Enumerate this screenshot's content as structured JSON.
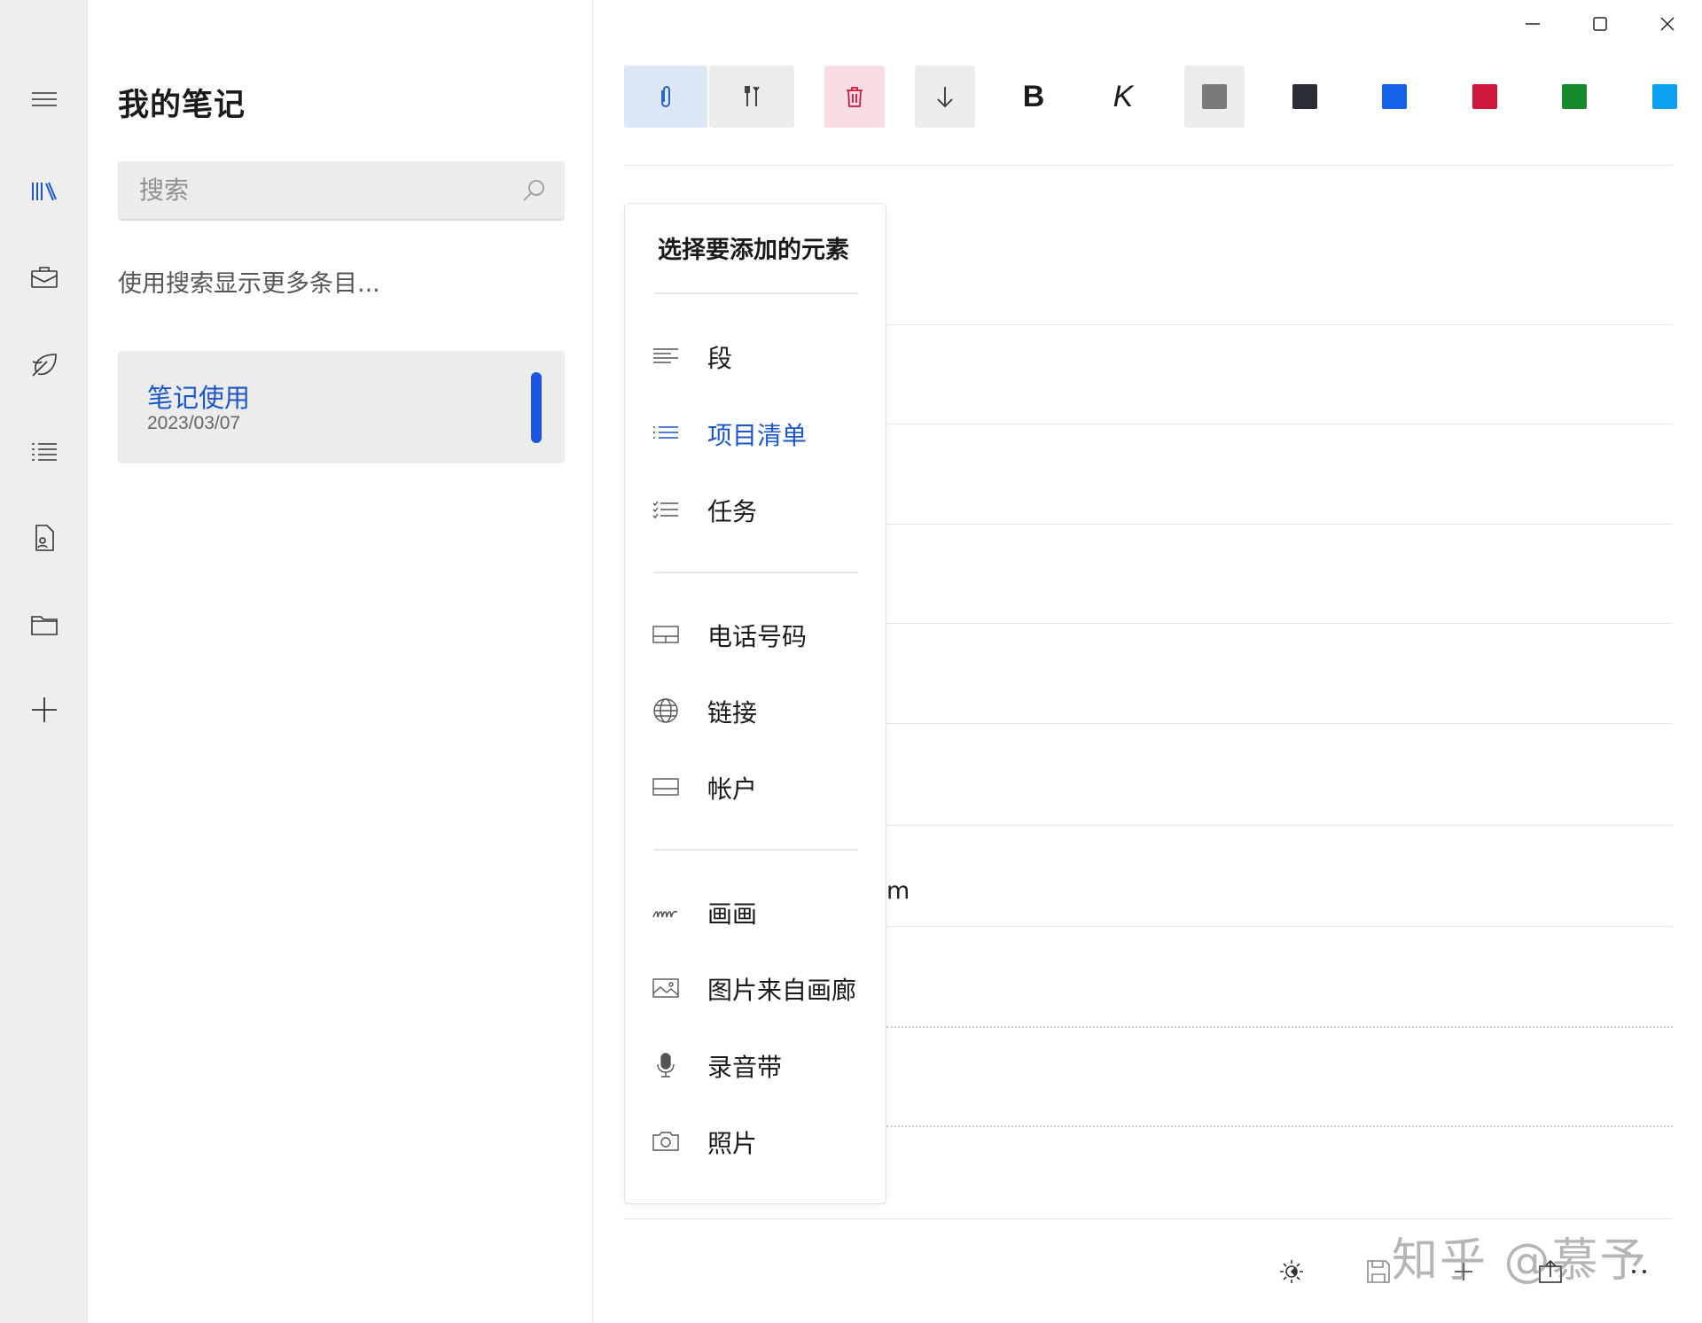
{
  "window": {
    "minimize_icon": "minimize-icon",
    "maximize_icon": "maximize-icon",
    "close_icon": "close-icon"
  },
  "rail": {
    "items": [
      {
        "icon": "hamburger-menu-icon"
      },
      {
        "icon": "library-icon"
      },
      {
        "icon": "briefcase-icon"
      },
      {
        "icon": "leaf-icon"
      },
      {
        "icon": "list-icon"
      },
      {
        "icon": "document-person-icon"
      },
      {
        "icon": "folder-icon"
      },
      {
        "icon": "add-icon"
      }
    ]
  },
  "list": {
    "title": "我的笔记",
    "search_placeholder": "搜索",
    "hint": "使用搜索显示更多条目...",
    "notes": [
      {
        "title": "笔记使用",
        "date": "2023/03/07"
      }
    ]
  },
  "toolbar": {
    "bold_label": "B",
    "italic_label": "K",
    "colors": [
      "#7a7a7a",
      "#2b2d36",
      "#1560e8",
      "#d0163c",
      "#138a2c",
      "#0ea0f0"
    ]
  },
  "menu": {
    "title": "选择要添加的元素",
    "items": [
      {
        "label": "段",
        "icon": "paragraph-icon"
      },
      {
        "label": "项目清单",
        "icon": "bullet-list-icon"
      },
      {
        "label": "任务",
        "icon": "task-list-icon"
      },
      {
        "label": "电话号码",
        "icon": "phone-card-icon"
      },
      {
        "label": "链接",
        "icon": "globe-icon"
      },
      {
        "label": "帐户",
        "icon": "account-card-icon"
      },
      {
        "label": "画画",
        "icon": "scribble-icon"
      },
      {
        "label": "图片来自画廊",
        "icon": "image-icon"
      },
      {
        "label": "录音带",
        "icon": "microphone-icon"
      },
      {
        "label": "照片",
        "icon": "camera-icon"
      }
    ]
  },
  "editor": {
    "fragment_text": "m"
  },
  "watermark": "知乎 @慕予"
}
